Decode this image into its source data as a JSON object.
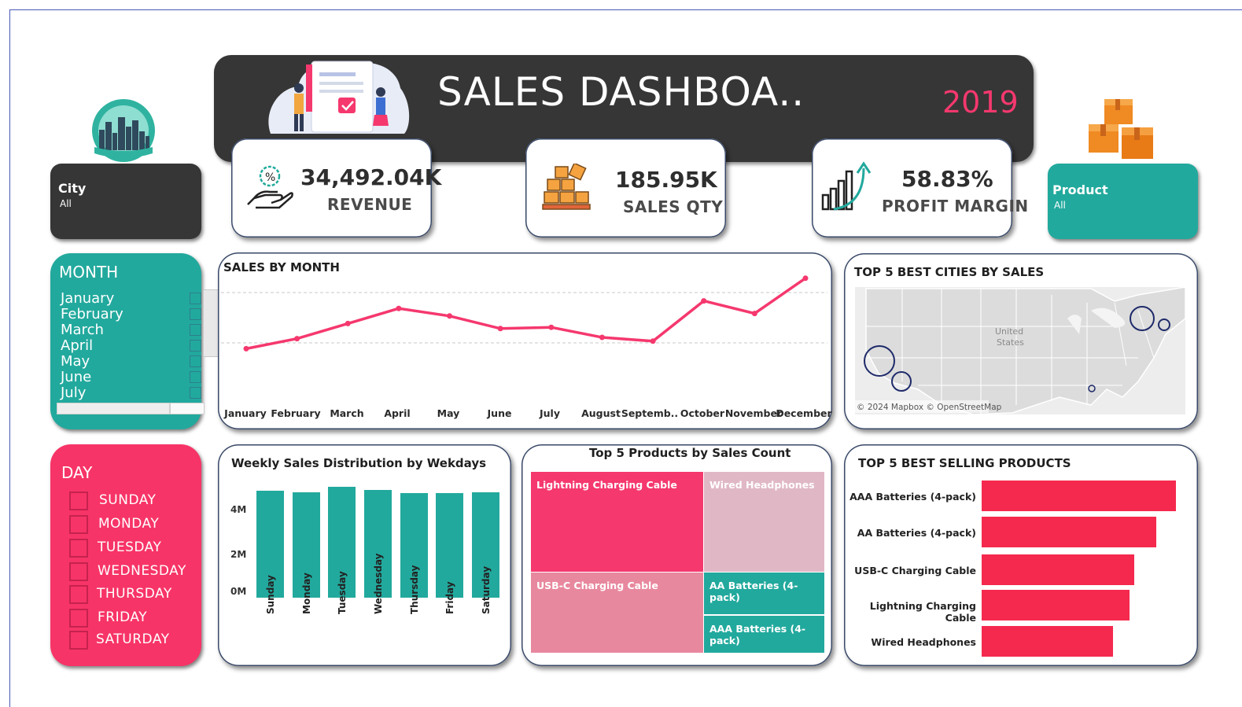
{
  "header": {
    "title": "SALES DASHBOA..",
    "year": "2019"
  },
  "kpis": [
    {
      "value": "34,492.04K",
      "label": "REVENUE",
      "icon": "hand-percent-icon"
    },
    {
      "value": "185.95K",
      "label": "SALES QTY",
      "icon": "boxes-icon"
    },
    {
      "value": "58.83%",
      "label": "PROFIT MARGIN",
      "icon": "growth-chart-icon"
    }
  ],
  "filters": {
    "city": {
      "title": "City",
      "value": "All"
    },
    "product": {
      "title": "Product",
      "value": "All"
    }
  },
  "month_filter": {
    "title": "MONTH",
    "items": [
      "January",
      "February",
      "March",
      "April",
      "May",
      "June",
      "July"
    ]
  },
  "day_filter": {
    "title": "DAY",
    "items": [
      "SUNDAY",
      "MONDAY",
      "TUESDAY",
      "WEDNESDAY",
      "THURSDAY",
      "FRIDAY",
      "SATURDAY"
    ]
  },
  "sales_by_month": {
    "title": "SALES BY MONTH",
    "chart_data": {
      "type": "line",
      "categories": [
        "January",
        "February",
        "March",
        "April",
        "May",
        "June",
        "July",
        "August",
        "Septemb..",
        "October",
        "November",
        "December"
      ],
      "values": [
        1.8,
        2.2,
        2.8,
        3.4,
        3.1,
        2.6,
        2.65,
        2.25,
        2.1,
        3.7,
        3.2,
        4.6
      ],
      "ylim": [
        0,
        5
      ],
      "color": "#f5386e",
      "grid": true
    }
  },
  "top_cities": {
    "title": "TOP 5 BEST CITIES BY SALES",
    "map_label_1": "United",
    "map_label_2": "States",
    "attribution": "© 2024 Mapbox © OpenStreetMap"
  },
  "weekly": {
    "title": "Weekly Sales Distribution by Wekdays",
    "chart_data": {
      "type": "bar",
      "categories": [
        "Sunday",
        "Monday",
        "Tuesday",
        "Wednesday",
        "Thursday",
        "Friday",
        "Saturday"
      ],
      "values": [
        4.85,
        4.8,
        5.05,
        4.9,
        4.75,
        4.75,
        4.8
      ],
      "yticks": [
        "0M",
        "2M",
        "4M"
      ],
      "ylim": [
        0,
        6
      ],
      "color": "#22a99d"
    }
  },
  "top_products_count": {
    "title": "Top 5 Products by Sales Count",
    "chart_data": {
      "type": "treemap",
      "items": [
        "Lightning Charging Cable",
        "Wired Headphones",
        "USB-C Charging Cable",
        "AA Batteries (4-pack)",
        "AAA Batteries (4-pack)"
      ]
    }
  },
  "top_selling": {
    "title": "TOP 5 BEST SELLING PRODUCTS",
    "chart_data": {
      "type": "bar",
      "orientation": "horizontal",
      "categories": [
        "AAA Batteries (4-pack)",
        "AA Batteries (4-pack)",
        "USB-C Charging Cable",
        "Lightning Charging Cable",
        "Wired Headphones"
      ],
      "values": [
        31000,
        27800,
        24300,
        23600,
        21000
      ],
      "xlim": [
        0,
        31000
      ],
      "color": "#f5294e"
    }
  }
}
